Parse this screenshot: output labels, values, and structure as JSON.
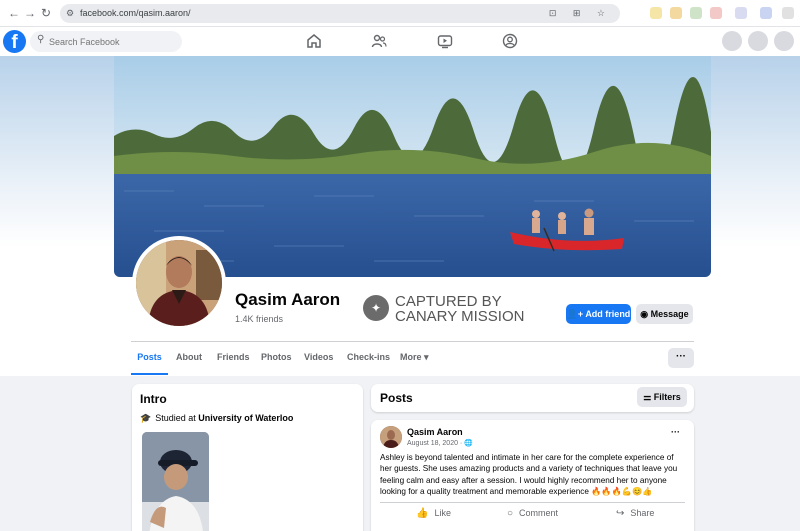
{
  "browser": {
    "url": "facebook.com/qasim.aaron/",
    "back_icon": "←",
    "forward_icon": "→",
    "reload_icon": "↻",
    "url_icons": "⊡ ⊞ ☆"
  },
  "header": {
    "logo": "f",
    "search_placeholder": "Search Facebook"
  },
  "profile": {
    "name": "Qasim Aaron",
    "friends": "1.4K friends",
    "stamp_line1": "CAPTURED BY",
    "stamp_line2": "CANARY MISSION",
    "add_friend": "Add friend",
    "message": "Message",
    "tabs": [
      "Posts",
      "About",
      "Friends",
      "Photos",
      "Videos",
      "Check-ins",
      "More ▾"
    ],
    "tabs_more_button": "···"
  },
  "intro": {
    "title": "Intro",
    "studied_prefix": "Studied at ",
    "school": "University of Waterloo"
  },
  "posts": {
    "title": "Posts",
    "filters": "Filters",
    "post": {
      "author": "Qasim Aaron",
      "date": "August 18, 2020 · ",
      "more": "···",
      "text": "Ashley is beyond talented and intimate in her care for the complete experience of her guests. She uses amazing products and a variety of techniques that leave you feeling calm and easy after a session. I would highly recommend her to anyone looking for a quality treatment and memorable experience ",
      "emoji": "🔥🔥🔥💪😊👍",
      "like": "Like",
      "comment": "Comment",
      "share": "Share"
    }
  },
  "colors": {
    "brand": "#1877f2",
    "background": "#f0f2f5"
  }
}
